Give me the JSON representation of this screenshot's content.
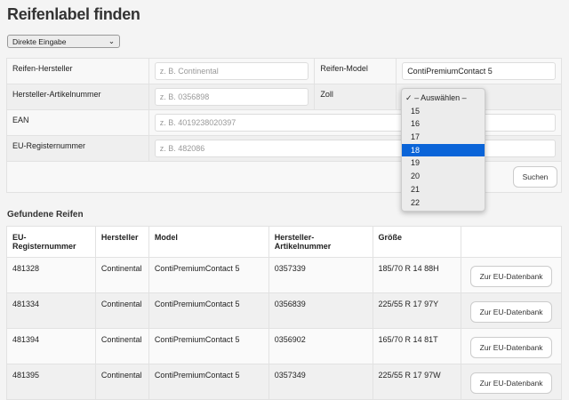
{
  "title": "Reifenlabel finden",
  "mode_select": "Direkte Eingabe",
  "form": {
    "manufacturer_label": "Reifen-Hersteller",
    "manufacturer_placeholder": "z. B. Continental",
    "model_label": "Reifen-Model",
    "model_value": "ContiPremiumContact 5",
    "article_label": "Hersteller-Artikelnummer",
    "article_placeholder": "z. B. 0356898",
    "zoll_label": "Zoll",
    "ean_label": "EAN",
    "ean_placeholder": "z. B. 4019238020397",
    "eu_label": "EU-Registernummer",
    "eu_placeholder": "z. B. 482086",
    "search_button": "Suchen"
  },
  "zoll_dropdown": {
    "checked": "✓",
    "options": [
      "– Auswählen –",
      "15",
      "16",
      "17",
      "18",
      "19",
      "20",
      "21",
      "22"
    ],
    "highlighted": "18"
  },
  "results": {
    "heading": "Gefundene Reifen",
    "columns": [
      "EU-Registernummer",
      "Hersteller",
      "Model",
      "Hersteller-Artikelnummer",
      "Größe",
      ""
    ],
    "button_label": "Zur EU-Datenbank",
    "rows": [
      [
        "481328",
        "Continental",
        "ContiPremiumContact 5",
        "0357339",
        "185/70 R 14 88H"
      ],
      [
        "481334",
        "Continental",
        "ContiPremiumContact 5",
        "0356839",
        "225/55 R 17 97Y"
      ],
      [
        "481394",
        "Continental",
        "ContiPremiumContact 5",
        "0356902",
        "165/70 R 14 81T"
      ],
      [
        "481395",
        "Continental",
        "ContiPremiumContact 5",
        "0357349",
        "225/55 R 17 97W"
      ]
    ]
  }
}
